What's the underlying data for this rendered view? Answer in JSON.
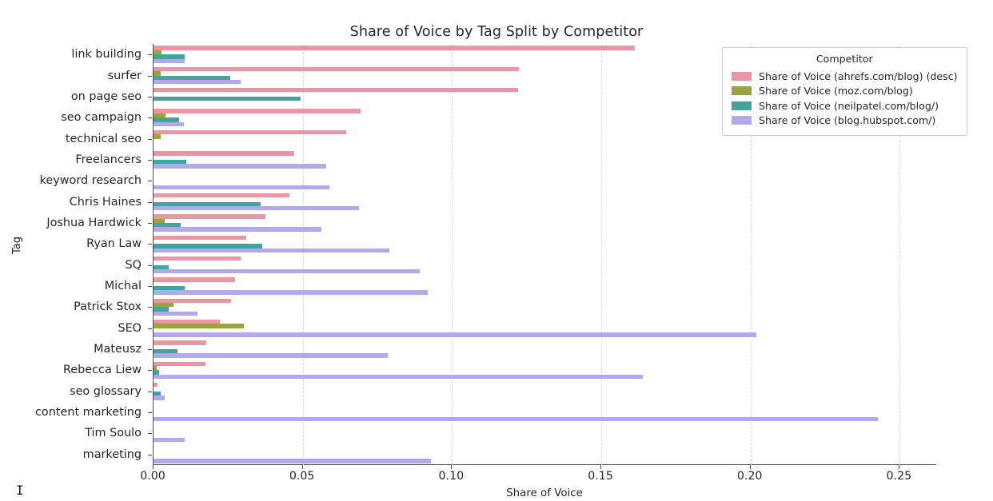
{
  "chart_data": {
    "type": "bar",
    "orientation": "horizontal",
    "title": "Share of Voice by Tag Split by Competitor",
    "xlabel": "Share of Voice",
    "ylabel": "Tag",
    "xlim": [
      0.0,
      0.2625
    ],
    "xticks": [
      0.0,
      0.05,
      0.1,
      0.15,
      0.2,
      0.25
    ],
    "xtick_labels": [
      "0.00",
      "0.05",
      "0.10",
      "0.15",
      "0.20",
      "0.25"
    ],
    "grid": "vertical-dashed",
    "legend_title": "Competitor",
    "legend_position": "upper right",
    "categories": [
      "link building",
      "surfer",
      "on page seo",
      "seo campaign",
      "technical seo",
      "Freelancers",
      "keyword research",
      "Chris Haines",
      "Joshua Hardwick",
      "Ryan Law",
      "SQ",
      "Michal",
      "Patrick Stox",
      "SEO",
      "Mateusz",
      "Rebecca Liew",
      "seo glossary",
      "content marketing",
      "Tim Soulo",
      "marketing"
    ],
    "series": [
      {
        "name": "Share of Voice (ahrefs.com/blog) (desc)",
        "color": "#eb96a4",
        "values": [
          0.1612,
          0.1225,
          0.1222,
          0.0693,
          0.0645,
          0.0472,
          0.0,
          0.0455,
          0.0374,
          0.031,
          0.0293,
          0.0272,
          0.026,
          0.0222,
          0.0177,
          0.0174,
          0.0013,
          0.0,
          0.0,
          0.0
        ]
      },
      {
        "name": "Share of Voice (moz.com/blog)",
        "color": "#9ca33e",
        "values": [
          0.0026,
          0.0023,
          0.0,
          0.004,
          0.0024,
          0.0,
          0.0,
          0.0,
          0.0038,
          0.0,
          0.0,
          0.0,
          0.0068,
          0.0302,
          0.0,
          0.001,
          0.0,
          0.0,
          0.0,
          0.0
        ]
      },
      {
        "name": "Share of Voice (neilpatel.com/blog/)",
        "color": "#40a59f",
        "values": [
          0.0105,
          0.0258,
          0.0493,
          0.0085,
          0.0,
          0.011,
          0.0,
          0.0358,
          0.0092,
          0.0363,
          0.0052,
          0.0105,
          0.005,
          0.0,
          0.008,
          0.0018,
          0.0023,
          0.0,
          0.0,
          0.0
        ]
      },
      {
        "name": "Share of Voice (blog.hubspot.com/)",
        "color": "#b3a7ee",
        "values": [
          0.0105,
          0.0293,
          0.0,
          0.0103,
          0.0,
          0.0578,
          0.0588,
          0.0688,
          0.0563,
          0.079,
          0.0893,
          0.092,
          0.0148,
          0.202,
          0.0785,
          0.1638,
          0.0038,
          0.2428,
          0.0105,
          0.093
        ]
      }
    ]
  },
  "legend": {
    "title": "Competitor",
    "entries": [
      {
        "label": "Share of Voice (ahrefs.com/blog) (desc)",
        "color": "#eb96a4"
      },
      {
        "label": "Share of Voice (moz.com/blog)",
        "color": "#9ca33e"
      },
      {
        "label": "Share of Voice (neilpatel.com/blog/)",
        "color": "#40a59f"
      },
      {
        "label": "Share of Voice (blog.hubspot.com/)",
        "color": "#b3a7ee"
      }
    ]
  },
  "cursor": {
    "glyph": "I"
  }
}
